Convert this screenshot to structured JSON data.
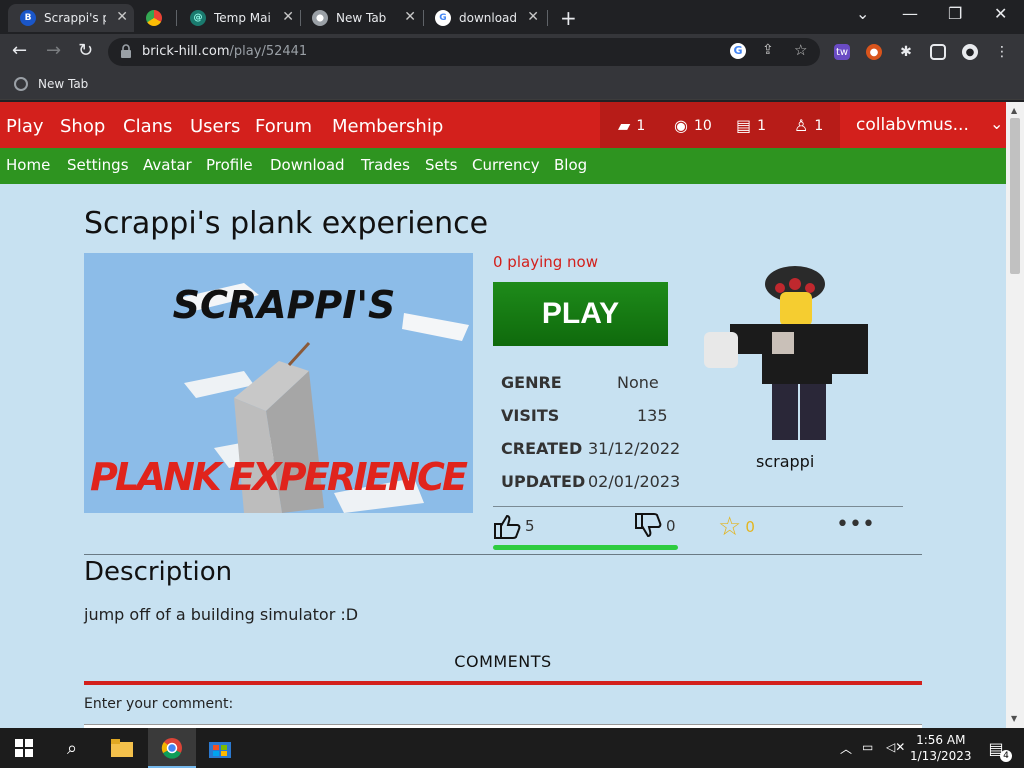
{
  "browser": {
    "tabs": [
      {
        "title": "Scrappi's pl",
        "active": true,
        "favicon": "brickhill-icon"
      },
      {
        "title": "",
        "active": false,
        "favicon": "chrome-store-icon"
      },
      {
        "title": "Temp Mail",
        "active": false,
        "favicon": "tempmail-icon"
      },
      {
        "title": "New Tab",
        "active": false,
        "favicon": "chrome-icon"
      },
      {
        "title": "download",
        "active": false,
        "favicon": "google-icon"
      }
    ],
    "url_domain": "brick-hill.com",
    "url_path": "/play/52441",
    "bookmark": "New Tab"
  },
  "site": {
    "nav": [
      "Play",
      "Shop",
      "Clans",
      "Users",
      "Forum",
      "Membership"
    ],
    "stats": {
      "bricks": "1",
      "bucks": "10",
      "messages": "1",
      "friends": "1"
    },
    "username": "collabvmus...",
    "subnav": [
      "Home",
      "Settings",
      "Avatar",
      "Profile",
      "Download",
      "Trades",
      "Sets",
      "Currency",
      "Blog"
    ]
  },
  "game": {
    "title": "Scrappi's plank experience",
    "thumbnail_top": "SCRAPPI'S",
    "thumbnail_bottom": "PLANK EXPERIENCE",
    "playing": "0 playing now",
    "play_label": "PLAY",
    "genre_label": "GENRE",
    "genre": "None",
    "visits_label": "VISITS",
    "visits": "135",
    "created_label": "CREATED",
    "created": "31/12/2022",
    "updated_label": "UPDATED",
    "updated": "02/01/2023",
    "creator": "scrappi",
    "upvotes": "5",
    "downvotes": "0",
    "favorites": "0",
    "description_title": "Description",
    "description": "jump off of a building simulator :D",
    "comments_title": "COMMENTS",
    "comment_prompt": "Enter your comment:"
  },
  "taskbar": {
    "time": "1:56 AM",
    "date": "1/13/2023",
    "notifications": "4"
  },
  "colors": {
    "nav_red": "#d3201c",
    "subnav_green": "#2e9420",
    "page_bg": "#c7e1f1",
    "play_green": "#1e8b1a"
  }
}
